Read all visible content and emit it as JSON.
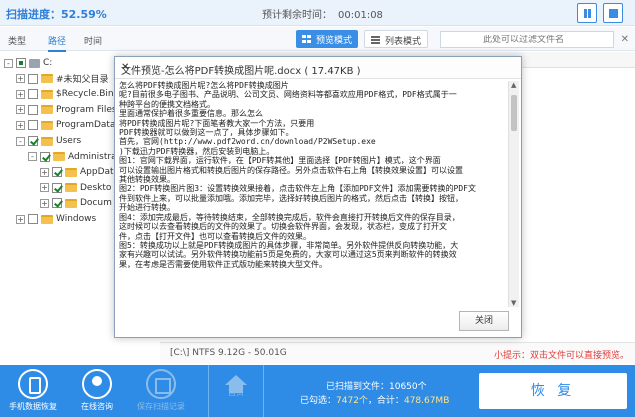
{
  "topbar": {
    "scan_progress": "扫描进度：52.59%",
    "remaining_label": "预计剩余时间：",
    "remaining_time": "00:01:08"
  },
  "tabs": [
    {
      "label": "类型",
      "active": false
    },
    {
      "label": "路径",
      "active": true
    },
    {
      "label": "时间",
      "active": false
    }
  ],
  "views": {
    "preview": "预览模式",
    "list": "列表模式"
  },
  "filter": {
    "placeholder": "此处可以过滤文件名"
  },
  "tree": [
    {
      "label": "C:",
      "checked": "partial",
      "level": 0,
      "kind": "drive",
      "expand": "-"
    },
    {
      "label": "#未知父目录",
      "checked": "off",
      "level": 1,
      "kind": "folder",
      "expand": "+"
    },
    {
      "label": "$Recycle.Bin",
      "checked": "off",
      "level": 1,
      "kind": "folder",
      "expand": "+"
    },
    {
      "label": "Program Files",
      "checked": "off",
      "level": 1,
      "kind": "folder",
      "expand": "+"
    },
    {
      "label": "ProgramData",
      "checked": "off",
      "level": 1,
      "kind": "folder",
      "expand": "+"
    },
    {
      "label": "Users",
      "checked": "on",
      "level": 1,
      "kind": "folder",
      "expand": "-"
    },
    {
      "label": "Administra",
      "checked": "on",
      "level": 2,
      "kind": "folder",
      "expand": "-"
    },
    {
      "label": "AppDat",
      "checked": "on",
      "level": 3,
      "kind": "folder",
      "expand": "+"
    },
    {
      "label": "Deskto",
      "checked": "on",
      "level": 3,
      "kind": "folder",
      "expand": "+"
    },
    {
      "label": "Docum",
      "checked": "on",
      "level": 3,
      "kind": "folder",
      "expand": "+"
    },
    {
      "label": "Windows",
      "checked": "off",
      "level": 1,
      "kind": "folder",
      "expand": "+"
    }
  ],
  "status": {
    "disk": "[C:\\] NTFS 9.12G - 50.01G",
    "tip": "小提示：双击文件可以直接预览。"
  },
  "modal": {
    "title": "文件预览-怎么将PDF转换成图片呢.docx ( 17.47KB )",
    "close_label": "关闭",
    "body": "怎么将PDF转换成图片呢?怎么将PDF转换成图片\n呢?目前很多电子图书、产品说明、公司文员、网络资料等都喜欢应用PDF格式，PDF格式属于一\n种跨平台的便携文档格式。\n里面通常保护着很多重要信息。那么怎么\n将PDF转换成图片呢?下面笔者教大家一个方法，只要用\nPDF转换器就可以做到这一点了，具体步骤如下。\n首先，官网(http://www.pdf2word.cn/download/P2WSetup.exe\n)下载迅力PDF转换器，然后安装到电脑上。\n图1：官网下载界面，运行软件，在【PDF转其他】里面选择【PDF转图片】模式，这个界面\n可以设置输出图片格式和转换后图片的保存路径。另外点击软件右上角【转换效果设置】可以设置\n其他转换效果。\n图2：PDF转换图片图3：设置转换效果接着，点击软件左上角【添加PDF文件】添加需要转换的PDF文\n件到软件上来，可以批量添加哦。添加完毕，选择好转换后图片的格式，然后点击【转换】按钮，\n开始进行转换。\n图4：添加完成最后，等待转换结束，全部转换完成后，软件会直接打开转换后文件的保存目录，\n这时候可以去查看转换后的文件的效果了。切换会软件界面，会发现，状态栏，变成了打开文\n件，点击【打开文件】也可以查看转换后文件的效果。\n图5：转换成功以上就是PDF转换成图片的具体步骤，非常简单。另外软件提供反向转换功能，大\n家有兴趣可以试试。另外软件转换功能前5页是免费的，大家可以通过这5页来判断软件的转换效\n果，在考虑是否需要使用软件正式版功能来转换大型文件。"
  },
  "bottom": {
    "items": [
      {
        "label": "手机数据恢复",
        "icon": "phone-icon",
        "enabled": true
      },
      {
        "label": "在线咨询",
        "icon": "agent-icon",
        "enabled": true
      },
      {
        "label": "保存扫描记录",
        "icon": "save-icon",
        "enabled": false
      }
    ],
    "home_label": "首页",
    "found_label": "已扫描到文件：10650个",
    "selected_prefix": "已勾选：",
    "selected_count": "7472个",
    "total_prefix": "，合计：",
    "total_size": "478.67MB",
    "recover_label": "恢 复"
  },
  "colors": {
    "accent": "#2e8be6",
    "tip": "#e23b3b"
  }
}
